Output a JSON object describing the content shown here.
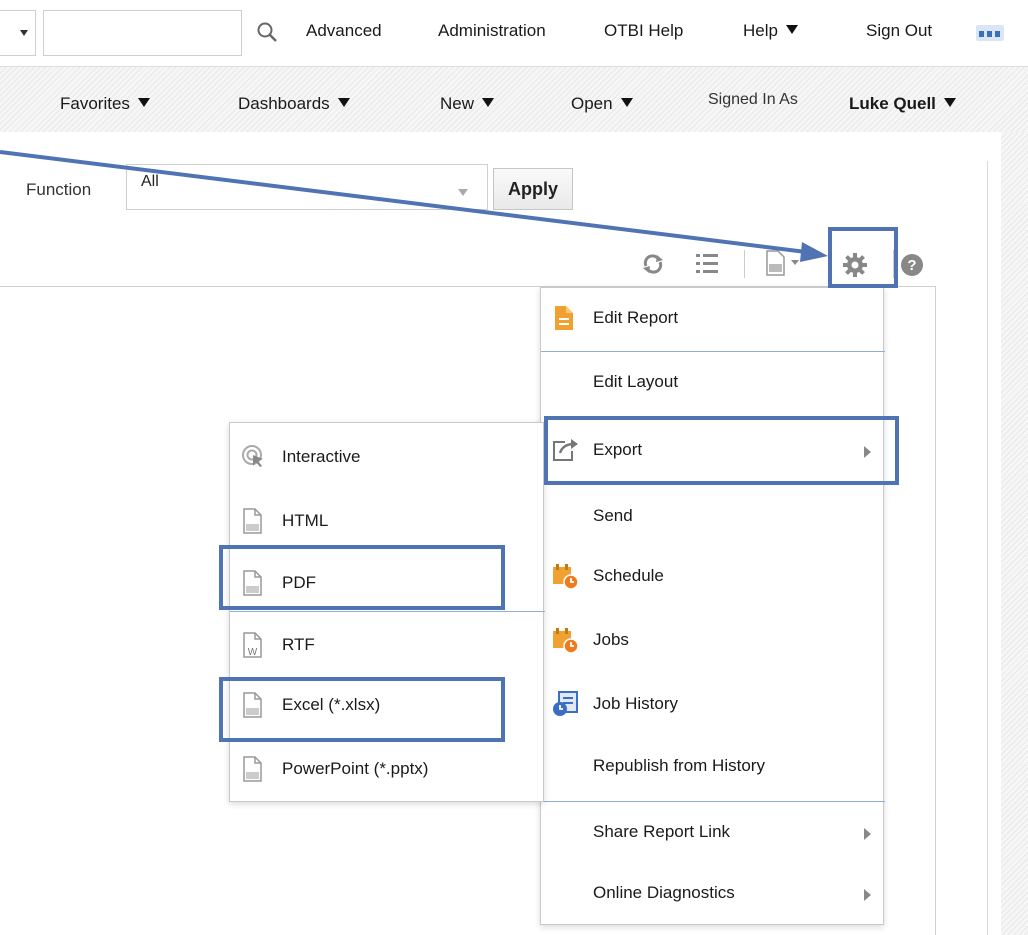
{
  "topbar": {
    "search_value": "",
    "links": [
      "Advanced",
      "Administration",
      "OTBI Help",
      "Help",
      "Sign Out"
    ]
  },
  "navbar": {
    "items": [
      "Favorites",
      "Dashboards",
      "New",
      "Open"
    ],
    "signed_in_label": "Signed In As",
    "user_name": "Luke Quell"
  },
  "filter": {
    "label": "Function",
    "value": "All",
    "apply_label": "Apply"
  },
  "actions_menu": {
    "items": [
      {
        "label": "Edit Report",
        "icon": "edit-report-icon"
      },
      {
        "label": "Edit Layout",
        "icon": ""
      },
      {
        "label": "Export",
        "icon": "export-icon",
        "submenu": true
      },
      {
        "label": "Send",
        "icon": ""
      },
      {
        "label": "Schedule",
        "icon": "schedule-icon"
      },
      {
        "label": "Jobs",
        "icon": "jobs-icon"
      },
      {
        "label": "Job History",
        "icon": "job-history-icon"
      },
      {
        "label": "Republish from History",
        "icon": ""
      },
      {
        "label": "Share Report Link",
        "icon": "",
        "submenu": true
      },
      {
        "label": "Online Diagnostics",
        "icon": "",
        "submenu": true
      }
    ]
  },
  "export_menu": {
    "items": [
      {
        "label": "Interactive",
        "icon": "interactive-icon"
      },
      {
        "label": "HTML",
        "icon": "html-file-icon"
      },
      {
        "label": "PDF",
        "icon": "pdf-file-icon"
      },
      {
        "label": "RTF",
        "icon": "rtf-file-icon",
        "badge": "W"
      },
      {
        "label": "Excel (*.xlsx)",
        "icon": "excel-file-icon"
      },
      {
        "label": "PowerPoint (*.pptx)",
        "icon": "powerpoint-file-icon"
      }
    ]
  },
  "colors": {
    "highlight": "#4f73b3",
    "menu_divider": "#8fb0d6",
    "icon_orange": "#f0a132",
    "icon_blue": "#3a6ec0"
  }
}
